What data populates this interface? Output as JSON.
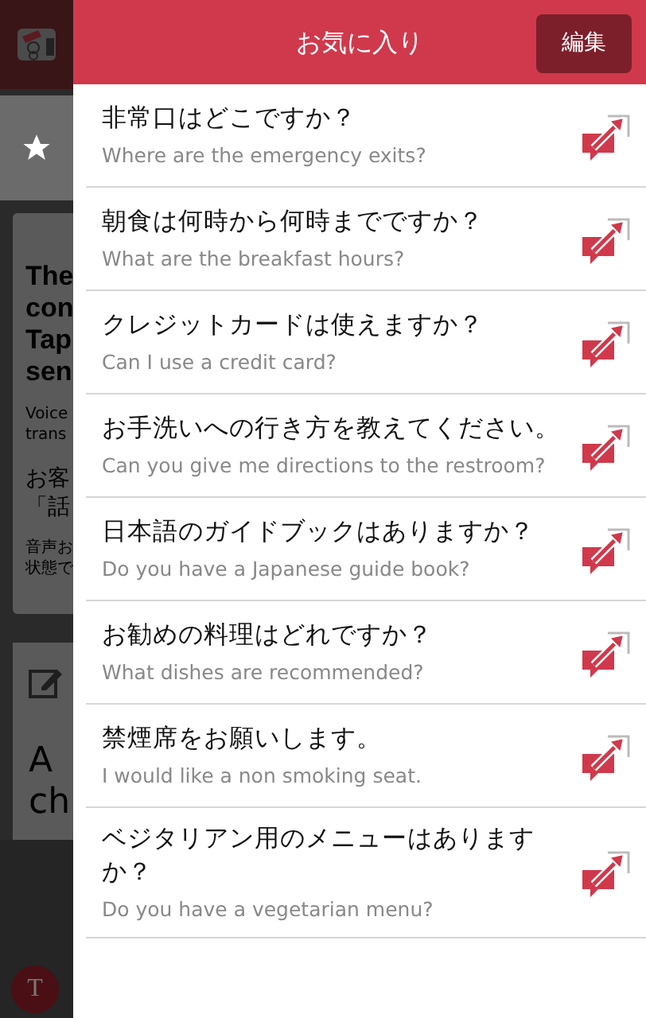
{
  "header": {
    "title": "お気に入り",
    "edit_button": "編集"
  },
  "favorites": [
    {
      "japanese": "非常口はどこですか？",
      "english": "Where are the emergency exits?"
    },
    {
      "japanese": "朝食は何時から何時までですか？",
      "english": "What are the breakfast hours?"
    },
    {
      "japanese": "クレジットカードは使えますか？",
      "english": "Can I use a credit card?"
    },
    {
      "japanese": "お手洗いへの行き方を教えてください。",
      "english": "Can you give me directions to the restroom?"
    },
    {
      "japanese": "日本語のガイドブックはありますか？",
      "english": "Do you have a Japanese guide book?"
    },
    {
      "japanese": "お勧めの料理はどれですか？",
      "english": "What dishes are recommended?"
    },
    {
      "japanese": "禁煙席をお願いします。",
      "english": "I would like a non smoking seat."
    },
    {
      "japanese": "ベジタリアン用のメニューはありますか？",
      "english": "Do you have a vegetarian menu?"
    }
  ],
  "background": {
    "card_title_lines": [
      "The",
      "con",
      "Tap",
      "sen"
    ],
    "card_note_lines": [
      "Voice",
      "trans"
    ],
    "card_jp_lines": [
      "お客",
      "「話"
    ],
    "card_jp_note_lines": [
      "音声お",
      "状態で"
    ],
    "second_card_lines": [
      "A",
      "ch"
    ],
    "avatar_letter": "T"
  }
}
